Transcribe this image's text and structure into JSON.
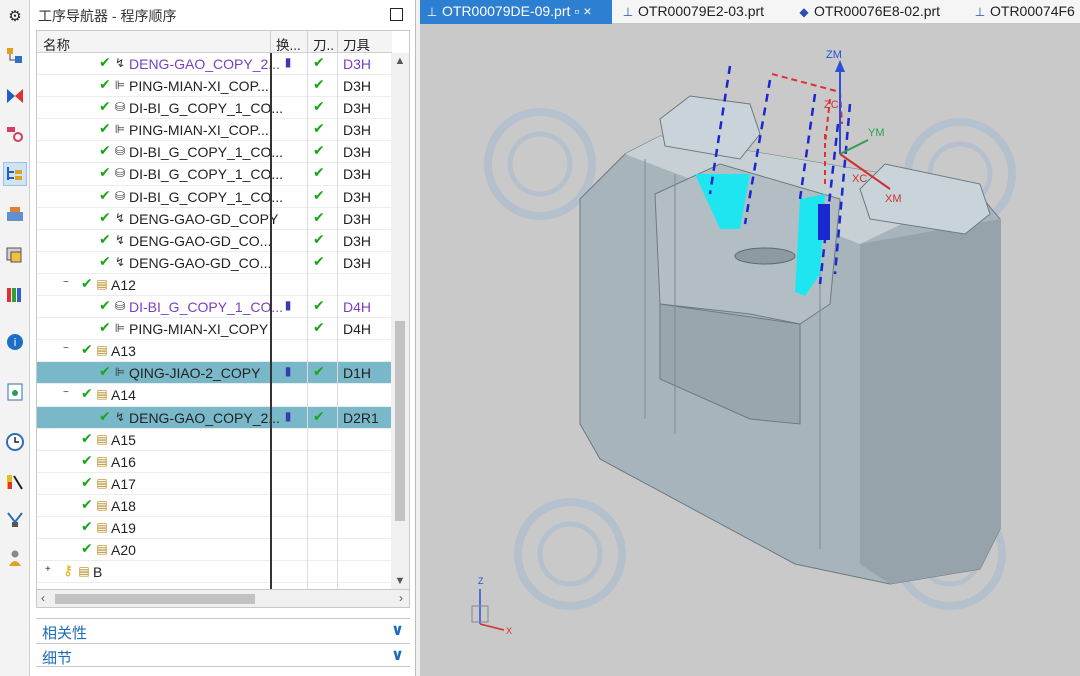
{
  "navigator": {
    "title": "工序导航器 - 程序顺序",
    "columns": [
      "名称",
      "换...",
      "刀..",
      "刀具"
    ],
    "rows": [
      {
        "indent": 3,
        "expander": "",
        "check": true,
        "icon": "deng-gao-icon",
        "name": "DENG-GAO_COPY_2...",
        "purple": true,
        "col2": "▮",
        "col3": true,
        "tool": "D3H",
        "sel": false
      },
      {
        "indent": 3,
        "expander": "",
        "check": true,
        "icon": "planar-icon",
        "name": "PING-MIAN-XI_COP...",
        "purple": false,
        "col2": "",
        "col3": true,
        "tool": "D3H",
        "sel": false
      },
      {
        "indent": 3,
        "expander": "",
        "check": true,
        "icon": "cavity-icon",
        "name": "DI-BI_G_COPY_1_CO...",
        "purple": false,
        "col2": "",
        "col3": true,
        "tool": "D3H",
        "sel": false
      },
      {
        "indent": 3,
        "expander": "",
        "check": true,
        "icon": "planar-icon",
        "name": "PING-MIAN-XI_COP...",
        "purple": false,
        "col2": "",
        "col3": true,
        "tool": "D3H",
        "sel": false
      },
      {
        "indent": 3,
        "expander": "",
        "check": true,
        "icon": "cavity-icon",
        "name": "DI-BI_G_COPY_1_CO...",
        "purple": false,
        "col2": "",
        "col3": true,
        "tool": "D3H",
        "sel": false
      },
      {
        "indent": 3,
        "expander": "",
        "check": true,
        "icon": "cavity-icon",
        "name": "DI-BI_G_COPY_1_CO...",
        "purple": false,
        "col2": "",
        "col3": true,
        "tool": "D3H",
        "sel": false
      },
      {
        "indent": 3,
        "expander": "",
        "check": true,
        "icon": "cavity-icon",
        "name": "DI-BI_G_COPY_1_CO...",
        "purple": false,
        "col2": "",
        "col3": true,
        "tool": "D3H",
        "sel": false
      },
      {
        "indent": 3,
        "expander": "",
        "check": true,
        "icon": "deng-gao-icon",
        "name": "DENG-GAO-GD_COPY",
        "purple": false,
        "col2": "",
        "col3": true,
        "tool": "D3H",
        "sel": false
      },
      {
        "indent": 3,
        "expander": "",
        "check": true,
        "icon": "deng-gao-icon",
        "name": "DENG-GAO-GD_CO...",
        "purple": false,
        "col2": "",
        "col3": true,
        "tool": "D3H",
        "sel": false
      },
      {
        "indent": 3,
        "expander": "",
        "check": true,
        "icon": "deng-gao-icon",
        "name": "DENG-GAO-GD_CO...",
        "purple": false,
        "col2": "",
        "col3": true,
        "tool": "D3H",
        "sel": false
      },
      {
        "indent": 2,
        "expander": "−",
        "check": true,
        "icon": "program-folder-icon",
        "name": "A12",
        "purple": false,
        "col2": "",
        "col3": false,
        "tool": "",
        "sel": false
      },
      {
        "indent": 3,
        "expander": "",
        "check": true,
        "icon": "cavity-icon",
        "name": "DI-BI_G_COPY_1_CO...",
        "purple": true,
        "col2": "▮",
        "col3": true,
        "tool": "D4H",
        "sel": false
      },
      {
        "indent": 3,
        "expander": "",
        "check": true,
        "icon": "planar-icon",
        "name": "PING-MIAN-XI_COPY",
        "purple": false,
        "col2": "",
        "col3": true,
        "tool": "D4H",
        "sel": false
      },
      {
        "indent": 2,
        "expander": "−",
        "check": true,
        "icon": "program-folder-icon",
        "name": "A13",
        "purple": false,
        "col2": "",
        "col3": false,
        "tool": "",
        "sel": false
      },
      {
        "indent": 3,
        "expander": "",
        "check": true,
        "icon": "planar-icon",
        "name": "QING-JIAO-2_COPY",
        "purple": false,
        "col2": "▮",
        "col3": true,
        "tool": "D1H",
        "sel": true
      },
      {
        "indent": 2,
        "expander": "−",
        "check": true,
        "icon": "program-folder-icon",
        "name": "A14",
        "purple": false,
        "col2": "",
        "col3": false,
        "tool": "",
        "sel": false
      },
      {
        "indent": 3,
        "expander": "",
        "check": true,
        "icon": "deng-gao-icon",
        "name": "DENG-GAO_COPY_2...",
        "purple": false,
        "col2": "▮",
        "col3": true,
        "tool": "D2R1",
        "sel": true
      },
      {
        "indent": 2,
        "expander": "",
        "check": true,
        "icon": "program-folder-icon",
        "name": "A15",
        "purple": false,
        "col2": "",
        "col3": false,
        "tool": "",
        "sel": false
      },
      {
        "indent": 2,
        "expander": "",
        "check": true,
        "icon": "program-folder-icon",
        "name": "A16",
        "purple": false,
        "col2": "",
        "col3": false,
        "tool": "",
        "sel": false
      },
      {
        "indent": 2,
        "expander": "",
        "check": true,
        "icon": "program-folder-icon",
        "name": "A17",
        "purple": false,
        "col2": "",
        "col3": false,
        "tool": "",
        "sel": false
      },
      {
        "indent": 2,
        "expander": "",
        "check": true,
        "icon": "program-folder-icon",
        "name": "A18",
        "purple": false,
        "col2": "",
        "col3": false,
        "tool": "",
        "sel": false
      },
      {
        "indent": 2,
        "expander": "",
        "check": true,
        "icon": "program-folder-icon",
        "name": "A19",
        "purple": false,
        "col2": "",
        "col3": false,
        "tool": "",
        "sel": false
      },
      {
        "indent": 2,
        "expander": "",
        "check": true,
        "icon": "program-folder-icon",
        "name": "A20",
        "purple": false,
        "col2": "",
        "col3": false,
        "tool": "",
        "sel": false
      },
      {
        "indent": 1,
        "expander": "+",
        "check": false,
        "icon": "program-folder-icon",
        "name": "B",
        "purple": false,
        "col2": "",
        "col3": false,
        "tool": "",
        "sel": false
      }
    ],
    "related_label": "相关性",
    "details_label": "细节"
  },
  "left_toolbar": [
    "settings-icon",
    "part-navigator-icon",
    "assembly-navigator-icon",
    "constraint-navigator-icon",
    "operation-navigator-icon",
    "machine-tool-icon",
    "reuse-library-icon",
    "palette-icon",
    "info-icon",
    "document-icon",
    "history-icon",
    "analysis-icon",
    "manufacturing-wizard-icon",
    "role-icon"
  ],
  "tabs": [
    {
      "label": "OTR00079DE-09.prt",
      "active": true
    },
    {
      "label": "OTR00079E2-03.prt",
      "active": false
    },
    {
      "label": "OTR00076E8-02.prt",
      "active": false
    },
    {
      "label": "OTR00074F6",
      "active": false
    }
  ],
  "viewport": {
    "axes": {
      "zm": "ZM",
      "ym": "YM",
      "xm": "XM",
      "zc": "ZC",
      "xc": "XC",
      "z": "Z",
      "x": "X"
    },
    "colors": {
      "background": "#c9c9c9",
      "part_face": "#a9b5bd",
      "tool_path": "#1a28d0",
      "cut_region": "#1ee6f0"
    }
  }
}
